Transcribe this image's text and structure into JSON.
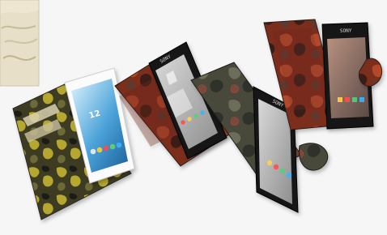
{
  "photo": {
    "subject": "camouflage-flip-phone-cases",
    "palette": {
      "yellow_camo": [
        "#3d3b24",
        "#b6a82e",
        "#6c6a39",
        "#1f1f18"
      ],
      "red_camo": [
        "#7c2d1e",
        "#b34a2c",
        "#3b1f18",
        "#5c3a2f"
      ],
      "olive_camo": [
        "#4a4a3b",
        "#6d6e5a",
        "#2f302a",
        "#7c4a3a"
      ]
    }
  },
  "phones": [
    {
      "id": "phone-white",
      "screen_time": "12"
    },
    {
      "id": "phone-black-1",
      "brand": "SONY"
    },
    {
      "id": "phone-black-2",
      "brand": "SONY"
    },
    {
      "id": "phone-black-3",
      "brand": "SONY"
    }
  ]
}
